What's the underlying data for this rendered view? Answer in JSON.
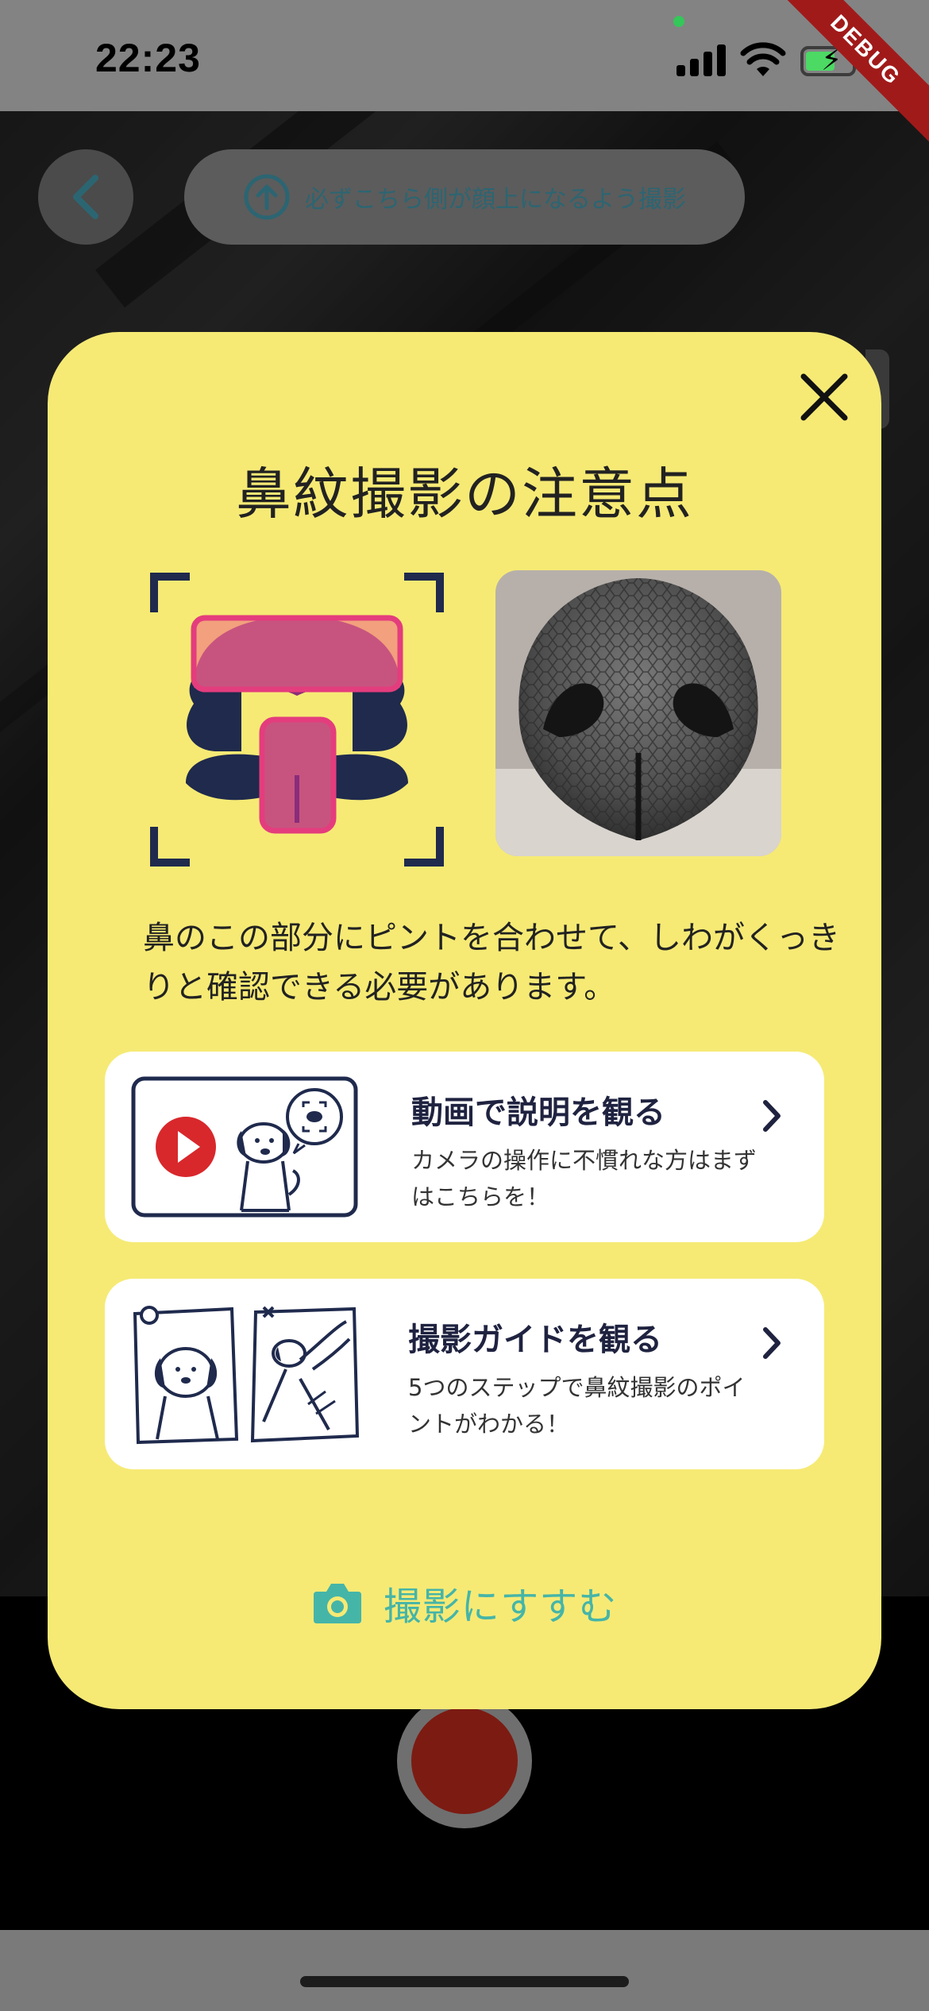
{
  "status_bar": {
    "time": "22:23",
    "debug_label": "DEBUG"
  },
  "camera": {
    "orientation_hint": "必ずこちら側が顔上になるよう撮影"
  },
  "modal": {
    "title": "鼻紋撮影の注意点",
    "description": "鼻のこの部分にピントを合わせて、しわがくっきりと確認できる必要があります。",
    "cards": [
      {
        "title": "動画で説明を観る",
        "subtitle": "カメラの操作に不慣れな方はまずはこちらを！"
      },
      {
        "title": "撮影ガイドを観る",
        "subtitle": "5つのステップで鼻紋撮影のポイントがわかる！"
      }
    ],
    "proceed_label": "撮影にすすむ"
  },
  "colors": {
    "modal_bg": "#f6ea75",
    "accent_teal": "#45b5a8",
    "diagram_navy": "#1f2a4d",
    "highlight_pink": "#e43d7d",
    "play_red": "#d8282c"
  },
  "icons": [
    "back-chevron-icon",
    "arrow-up-circle-icon",
    "close-icon",
    "chevron-right-icon",
    "camera-icon",
    "play-icon",
    "signal-icon",
    "wifi-icon",
    "battery-icon"
  ]
}
